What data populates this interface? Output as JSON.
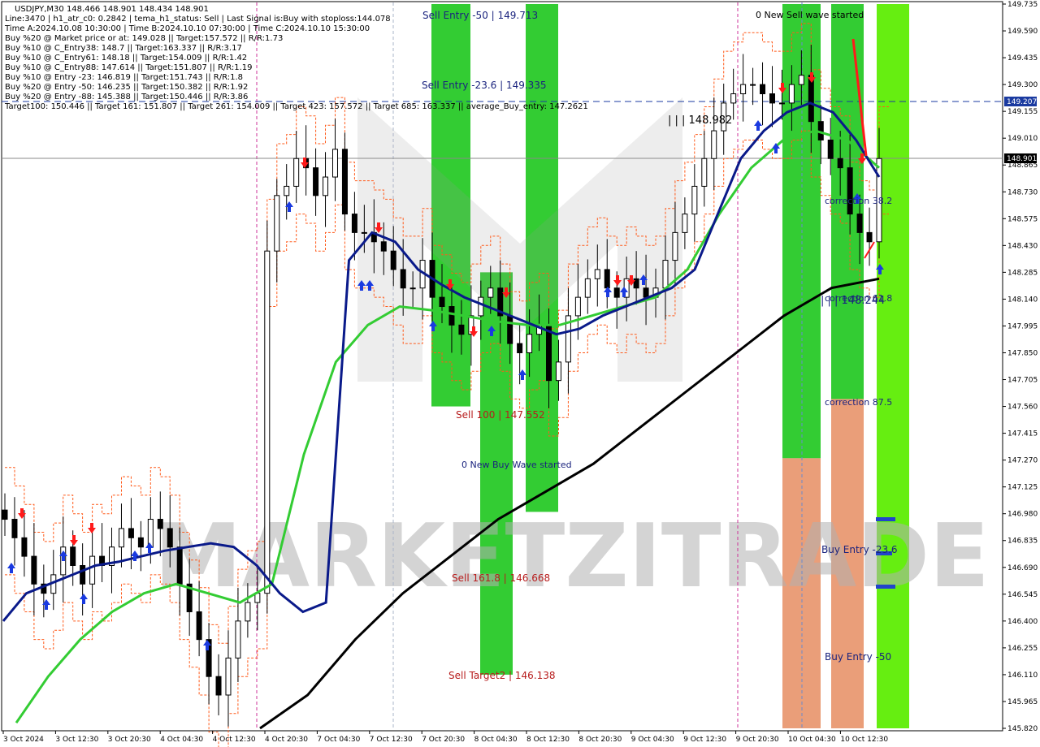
{
  "info_panel": [
    "USDJPY,M30  148.466 148.901 148.434 148.901",
    "Line:3470  |  h1_atr_c0: 0.2842  |  tema_h1_status: Sell  |  Last Signal is:Buy with stoploss:144.078",
    "Time A:2024.10.08 10:30:00  |  Time B:2024.10.10 07:30:00  |  Time C:2024.10.10 15:30:00",
    "Buy %20 @ Market price or at: 149.028  ||  Target:157.572  ||  R/R:1.73",
    "Buy %10 @ C_Entry38: 148.7  ||  Target:163.337  ||  R/R:3.17",
    "Buy %10 @ C_Entry61: 148.18  ||  Target:154.009  ||  R/R:1.42",
    "Buy %10 @ C_Entry88: 147.614  ||  Target:151.807  ||  R/R:1.19",
    "Buy %10 @ Entry -23: 146.819  ||  Target:151.743  ||  R/R:1.8",
    "Buy %20 @ Entry -50: 146.235  ||  Target:150.382  ||  R/R:1.92",
    "Buy %20 @ Entry -88: 145.388  ||  Target:150.446  ||  R/R:3.86",
    "Target100: 150.446  ||  Target 161: 151.807  ||  Target 261: 154.009  ||  Target 423: 157.572  ||  Target 685: 163.337  ||  average_Buy_entry: 147.2621"
  ],
  "annotations": [
    {
      "id": "sell-entry-50",
      "text": "Sell Entry -50 | 149.713",
      "color": "#1a237e"
    },
    {
      "id": "sell-entry-236",
      "text": "Sell Entry -23.6 | 149.335",
      "color": "#1a237e"
    },
    {
      "id": "sell-100",
      "text": "Sell 100 | 147.552",
      "color": "#b71c1c"
    },
    {
      "id": "new-buy-wave",
      "text": "0 New Buy Wave started",
      "color": "#1a237e"
    },
    {
      "id": "sell-1618",
      "text": "Sell 161.8 | 146.668",
      "color": "#b71c1c"
    },
    {
      "id": "sell-target2",
      "text": "Sell Target2 | 146.138",
      "color": "#b71c1c"
    },
    {
      "id": "new-sell-wave",
      "text": "0 New Sell wave started",
      "color": "#000000"
    },
    {
      "id": "level-148982",
      "text": "| | | 148.982",
      "color": "#000000"
    },
    {
      "id": "correction-382",
      "text": "correction 38.2",
      "color": "#1a237e"
    },
    {
      "id": "level-148244",
      "text": "| | | 148.244",
      "color": "#1a237e"
    },
    {
      "id": "correction-618",
      "text": "correction 61.8",
      "color": "#1a237e"
    },
    {
      "id": "correction-875",
      "text": "correction 87.5",
      "color": "#1a237e"
    },
    {
      "id": "buy-entry-236",
      "text": "Buy Entry -23.6",
      "color": "#1a237e"
    },
    {
      "id": "buy-entry-50",
      "text": "Buy Entry -50",
      "color": "#1a237e"
    }
  ],
  "watermark": "MARKETZITRADE",
  "colors": {
    "green_zone": "#33cc33",
    "bright_green_zone": "#66ee11",
    "orange_zone": "#e8a050",
    "salmon_zone": "#e8946a",
    "candle": "#000000",
    "tema_line": "#0a1a8a",
    "ma_green": "#33cc33",
    "ma_black": "#000000",
    "dashed_hline": "#1a3aa0",
    "current_price_tag": "#000000",
    "level_tag": "#1a3aa0"
  },
  "price_tags": {
    "current": "148.901",
    "level": "149.207"
  },
  "chart_data": {
    "type": "candlestick",
    "symbol": "USDJPY",
    "timeframe": "M30",
    "ylim": [
      145.82,
      149.735
    ],
    "y_ticks": [
      "149.735",
      "149.590",
      "149.435",
      "149.300",
      "149.155",
      "149.010",
      "148.865",
      "148.730",
      "148.575",
      "148.430",
      "148.285",
      "148.140",
      "147.995",
      "147.850",
      "147.705",
      "147.560",
      "147.415",
      "147.270",
      "147.125",
      "146.980",
      "146.835",
      "146.690",
      "146.545",
      "146.400",
      "146.255",
      "146.110",
      "145.965",
      "145.820"
    ],
    "x_ticks": [
      "3 Oct 2024",
      "3 Oct 12:30",
      "3 Oct 20:30",
      "4 Oct 04:30",
      "4 Oct 12:30",
      "4 Oct 20:30",
      "7 Oct 04:30",
      "7 Oct 12:30",
      "7 Oct 20:30",
      "8 Oct 04:30",
      "8 Oct 12:30",
      "8 Oct 20:30",
      "9 Oct 04:30",
      "9 Oct 12:30",
      "9 Oct 20:30",
      "10 Oct 04:30",
      "10 Oct 12:30"
    ],
    "current_price": 148.901,
    "dashed_level": 149.207,
    "close_series": [
      146.95,
      146.85,
      146.75,
      146.6,
      146.55,
      146.65,
      146.8,
      146.7,
      146.6,
      146.75,
      146.7,
      146.8,
      146.9,
      146.85,
      146.8,
      146.95,
      146.9,
      146.8,
      146.6,
      146.45,
      146.3,
      146.1,
      146.0,
      146.2,
      146.4,
      146.5,
      146.55,
      148.4,
      148.7,
      148.75,
      148.9,
      148.85,
      148.7,
      148.8,
      148.95,
      148.6,
      148.5,
      148.5,
      148.45,
      148.4,
      148.3,
      148.2,
      148.2,
      148.35,
      148.15,
      148.1,
      148.0,
      147.95,
      148.05,
      148.15,
      148.2,
      148.05,
      147.9,
      147.85,
      147.95,
      148.0,
      147.7,
      147.8,
      148.05,
      148.15,
      148.25,
      148.3,
      148.2,
      148.15,
      148.25,
      148.2,
      148.15,
      148.2,
      148.35,
      148.5,
      148.6,
      148.75,
      148.9,
      149.05,
      149.2,
      149.25,
      149.3,
      149.3,
      149.25,
      149.2,
      149.2,
      149.3,
      149.35,
      149.1,
      149.0,
      148.9,
      148.85,
      148.6,
      148.5,
      148.45,
      148.9
    ],
    "tema_series": [
      146.4,
      146.55,
      146.6,
      146.65,
      146.7,
      146.72,
      146.75,
      146.78,
      146.8,
      146.82,
      146.8,
      146.7,
      146.55,
      146.45,
      146.5,
      148.35,
      148.5,
      148.45,
      148.3,
      148.22,
      148.15,
      148.1,
      148.05,
      148.0,
      147.95,
      147.98,
      148.05,
      148.1,
      148.15,
      148.2,
      148.3,
      148.6,
      148.9,
      149.05,
      149.15,
      149.2,
      149.15,
      149.0,
      148.8
    ],
    "ma_green_series": [
      145.85,
      146.1,
      146.3,
      146.45,
      146.55,
      146.6,
      146.55,
      146.5,
      146.6,
      147.3,
      147.8,
      148.0,
      148.1,
      148.08,
      148.05,
      148.02,
      148.0,
      148.0,
      148.05,
      148.1,
      148.15,
      148.3,
      148.6,
      148.85,
      149.0,
      149.05,
      149.0,
      148.85
    ],
    "ma_black_series": [
      145.82,
      146.0,
      146.3,
      146.55,
      146.75,
      146.95,
      147.1,
      147.25,
      147.45,
      147.65,
      147.85,
      148.05,
      148.2,
      148.25
    ],
    "zones": [
      {
        "color": "orange",
        "from": 149.735,
        "to": 149.0
      },
      {
        "color": "green",
        "from": 149.735,
        "to": 147.56
      },
      {
        "color": "green",
        "from": 148.285,
        "to": 146.11
      },
      {
        "color": "green",
        "from": 149.735,
        "to": 146.99
      },
      {
        "color": "green",
        "from": 149.735,
        "to": 147.28
      },
      {
        "color": "orange",
        "from": 147.28,
        "to": 145.82
      },
      {
        "color": "green",
        "from": 149.735,
        "to": 147.6
      },
      {
        "color": "orange",
        "from": 147.6,
        "to": 145.82
      },
      {
        "color": "bright-green",
        "from": 149.735,
        "to": 145.82
      }
    ]
  }
}
